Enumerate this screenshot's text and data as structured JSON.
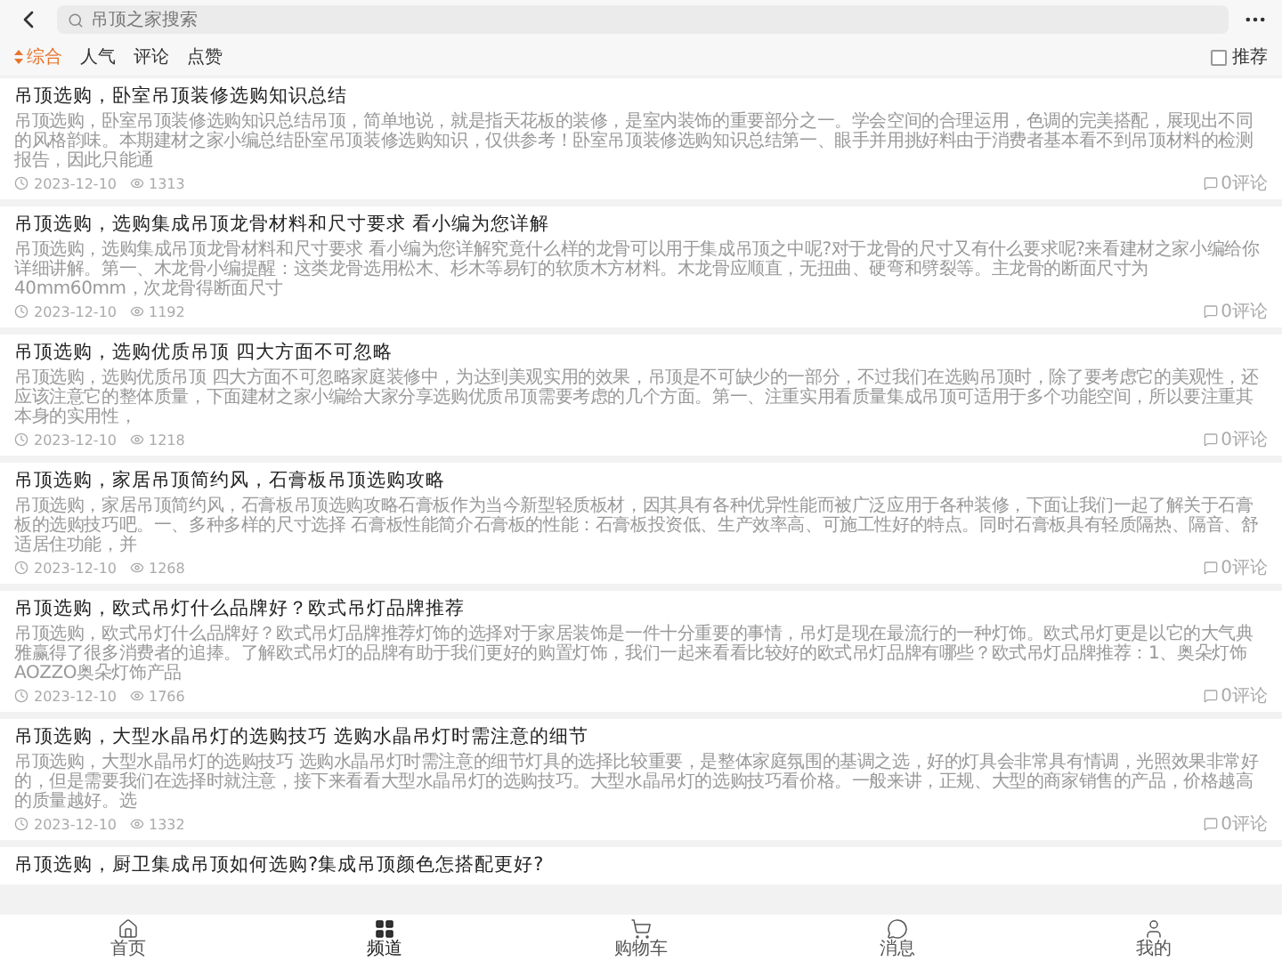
{
  "search": {
    "placeholder": "吊顶之家搜索"
  },
  "sort_tabs": [
    {
      "label": "综合",
      "selected": true
    },
    {
      "label": "人气",
      "selected": false
    },
    {
      "label": "评论",
      "selected": false
    },
    {
      "label": "点赞",
      "selected": false
    }
  ],
  "recommend": {
    "label": "推荐",
    "checked": false
  },
  "articles": [
    {
      "title": "吊顶选购，卧室吊顶装修选购知识总结",
      "summary": "吊顶选购，卧室吊顶装修选购知识总结吊顶，简单地说，就是指天花板的装修，是室内装饰的重要部分之一。学会空间的合理运用，色调的完美搭配，展现出不同的风格韵味。本期建材之家小编总结卧室吊顶装修选购知识，仅供参考！卧室吊顶装修选购知识总结第一、眼手并用挑好料由于消费者基本看不到吊顶材料的检测报告，因此只能通",
      "date": "2023-12-10",
      "views": "1313",
      "comments": "0评论"
    },
    {
      "title": "吊顶选购，选购集成吊顶龙骨材料和尺寸要求 看小编为您详解",
      "summary": "吊顶选购，选购集成吊顶龙骨材料和尺寸要求 看小编为您详解究竟什么样的龙骨可以用于集成吊顶之中呢?对于龙骨的尺寸又有什么要求呢?来看建材之家小编给你详细讲解。第一、木龙骨小编提醒：这类龙骨选用松木、杉木等易钉的软质木方材料。木龙骨应顺直，无扭曲、硬弯和劈裂等。主龙骨的断面尺寸为40mm60mm，次龙骨得断面尺寸",
      "date": "2023-12-10",
      "views": "1192",
      "comments": "0评论"
    },
    {
      "title": "吊顶选购，选购优质吊顶 四大方面不可忽略",
      "summary": "吊顶选购，选购优质吊顶 四大方面不可忽略家庭装修中，为达到美观实用的效果，吊顶是不可缺少的一部分，不过我们在选购吊顶时，除了要考虑它的美观性，还应该注意它的整体质量，下面建材之家小编给大家分享选购优质吊顶需要考虑的几个方面。第一、注重实用看质量集成吊顶可适用于多个功能空间，所以要注重其本身的实用性，",
      "date": "2023-12-10",
      "views": "1218",
      "comments": "0评论"
    },
    {
      "title": "吊顶选购，家居吊顶简约风，石膏板吊顶选购攻略",
      "summary": "吊顶选购，家居吊顶简约风，石膏板吊顶选购攻略石膏板作为当今新型轻质板材，因其具有各种优异性能而被广泛应用于各种装修，下面让我们一起了解关于石膏板的选购技巧吧。一、多种多样的尺寸选择 石膏板性能简介石膏板的性能：石膏板投资低、生产效率高、可施工性好的特点。同时石膏板具有轻质隔热、隔音、舒适居住功能，并",
      "date": "2023-12-10",
      "views": "1268",
      "comments": "0评论"
    },
    {
      "title": "吊顶选购，欧式吊灯什么品牌好？欧式吊灯品牌推荐",
      "summary": "吊顶选购，欧式吊灯什么品牌好？欧式吊灯品牌推荐灯饰的选择对于家居装饰是一件十分重要的事情，吊灯是现在最流行的一种灯饰。欧式吊灯更是以它的大气典雅赢得了很多消费者的追捧。了解欧式吊灯的品牌有助于我们更好的购置灯饰，我们一起来看看比较好的欧式吊灯品牌有哪些？欧式吊灯品牌推荐：1、奥朵灯饰AOZZO奥朵灯饰产品",
      "date": "2023-12-10",
      "views": "1766",
      "comments": "0评论"
    },
    {
      "title": "吊顶选购，大型水晶吊灯的选购技巧 选购水晶吊灯时需注意的细节",
      "summary": "吊顶选购，大型水晶吊灯的选购技巧 选购水晶吊灯时需注意的细节灯具的选择比较重要，是整体家庭氛围的基调之选，好的灯具会非常具有情调，光照效果非常好的，但是需要我们在选择时就注意，接下来看看大型水晶吊灯的选购技巧。大型水晶吊灯的选购技巧看价格。一般来讲，正规、大型的商家销售的产品，价格越高的质量越好。选",
      "date": "2023-12-10",
      "views": "1332",
      "comments": "0评论"
    },
    {
      "title": "吊顶选购，厨卫集成吊顶如何选购?集成吊顶颜色怎搭配更好?"
    }
  ],
  "tab_bar": [
    {
      "label": "首页",
      "kind": "home",
      "selected": false
    },
    {
      "label": "频道",
      "kind": "grid",
      "selected": true
    },
    {
      "label": "购物车",
      "kind": "cart",
      "selected": false
    },
    {
      "label": "消息",
      "kind": "chat",
      "selected": false
    },
    {
      "label": "我的",
      "kind": "user",
      "selected": false
    }
  ]
}
